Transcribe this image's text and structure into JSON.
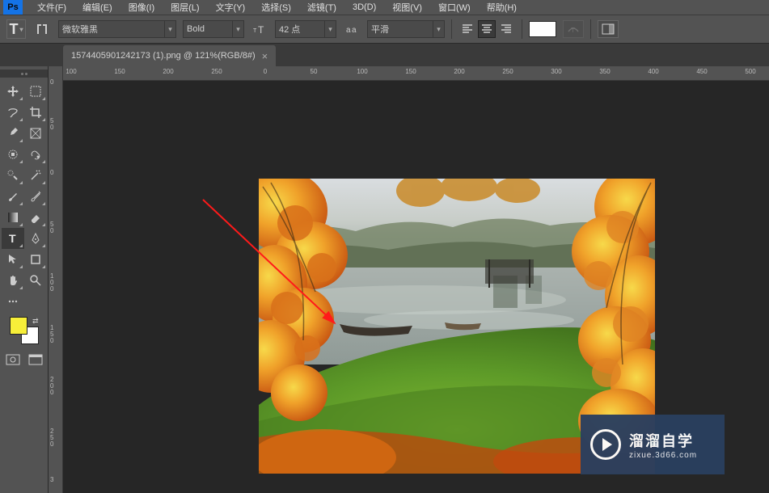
{
  "menubar": {
    "items": [
      {
        "label": "文件(F)"
      },
      {
        "label": "编辑(E)"
      },
      {
        "label": "图像(I)"
      },
      {
        "label": "图层(L)"
      },
      {
        "label": "文字(Y)"
      },
      {
        "label": "选择(S)"
      },
      {
        "label": "滤镜(T)"
      },
      {
        "label": "3D(D)"
      },
      {
        "label": "视图(V)"
      },
      {
        "label": "窗口(W)"
      },
      {
        "label": "帮助(H)"
      }
    ]
  },
  "optionsbar": {
    "tool_letter": "T",
    "font_family": "微软雅黑",
    "font_style": "Bold",
    "font_size": "42 点",
    "antialias": "平滑",
    "color": "#ffffff"
  },
  "tab": {
    "title": "1574405901242173 (1).png @ 121%(RGB/8#)",
    "close": "×"
  },
  "hruler": {
    "ticks": [
      {
        "pos": 88,
        "label": "100"
      },
      {
        "pos": 148,
        "label": "150"
      },
      {
        "pos": 208,
        "label": "200"
      },
      {
        "pos": 268,
        "label": "250"
      },
      {
        "pos": 328,
        "label": "0"
      },
      {
        "pos": 388,
        "label": "50"
      },
      {
        "pos": 448,
        "label": "100"
      },
      {
        "pos": 508,
        "label": "150"
      },
      {
        "pos": 568,
        "label": "200"
      },
      {
        "pos": 628,
        "label": "250"
      },
      {
        "pos": 688,
        "label": "300"
      },
      {
        "pos": 748,
        "label": "350"
      },
      {
        "pos": 808,
        "label": "400"
      },
      {
        "pos": 868,
        "label": "450"
      },
      {
        "pos": 928,
        "label": "500"
      }
    ]
  },
  "vruler": {
    "ticks": [
      {
        "pos": 16,
        "l1": "",
        "l2": "0"
      },
      {
        "pos": 64,
        "l1": "5",
        "l2": "0"
      },
      {
        "pos": 128,
        "l1": "",
        "l2": "0"
      },
      {
        "pos": 192,
        "l1": "5",
        "l2": "0"
      },
      {
        "pos": 256,
        "l1": "1",
        "l2": "0",
        "l3": "0"
      },
      {
        "pos": 320,
        "l1": "1",
        "l2": "5",
        "l3": "0"
      },
      {
        "pos": 384,
        "l1": "2",
        "l2": "0",
        "l3": "0"
      },
      {
        "pos": 448,
        "l1": "2",
        "l2": "5",
        "l3": "0"
      },
      {
        "pos": 508,
        "l1": "3",
        "l2": "",
        "l3": ""
      }
    ]
  },
  "colors": {
    "fg": "#f7ef39",
    "bg": "#ffffff"
  },
  "watermark": {
    "brand": "溜溜自学",
    "url": "zixue.3d66.com"
  }
}
